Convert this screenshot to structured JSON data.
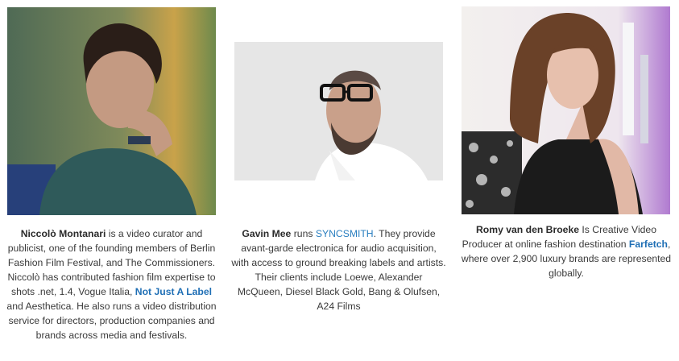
{
  "people": [
    {
      "name": "Niccolò Montanari",
      "bio_before_link": " is a video curator and publicist, one of the founding members of Berlin Fashion Film Festival, and The Commissioners. Niccolò has contributed fashion film expertise to shots .net, 1.4, Vogue Italia, ",
      "link": "Not Just A Label",
      "bio_after_link": " and Aesthetica. He also runs a video distribution service for directors, production companies and brands across media and festivals."
    },
    {
      "name": "Gavin Mee",
      "bio_before_link": " runs ",
      "link": "SYNCSMITH",
      "bio_after_link": ". They provide avant-garde electronica for audio acquisition, with access to ground breaking labels and artists. Their clients include Loewe, Alexander McQueen, Diesel Black Gold, Bang & Olufsen, A24 Films"
    },
    {
      "name": "Romy van den Broeke",
      "bio_before_link": " Is Creative Video Producer at online fashion destination ",
      "link": "Farfetch",
      "bio_after_link": ", where over 2,900 luxury brands are represented globally."
    }
  ]
}
